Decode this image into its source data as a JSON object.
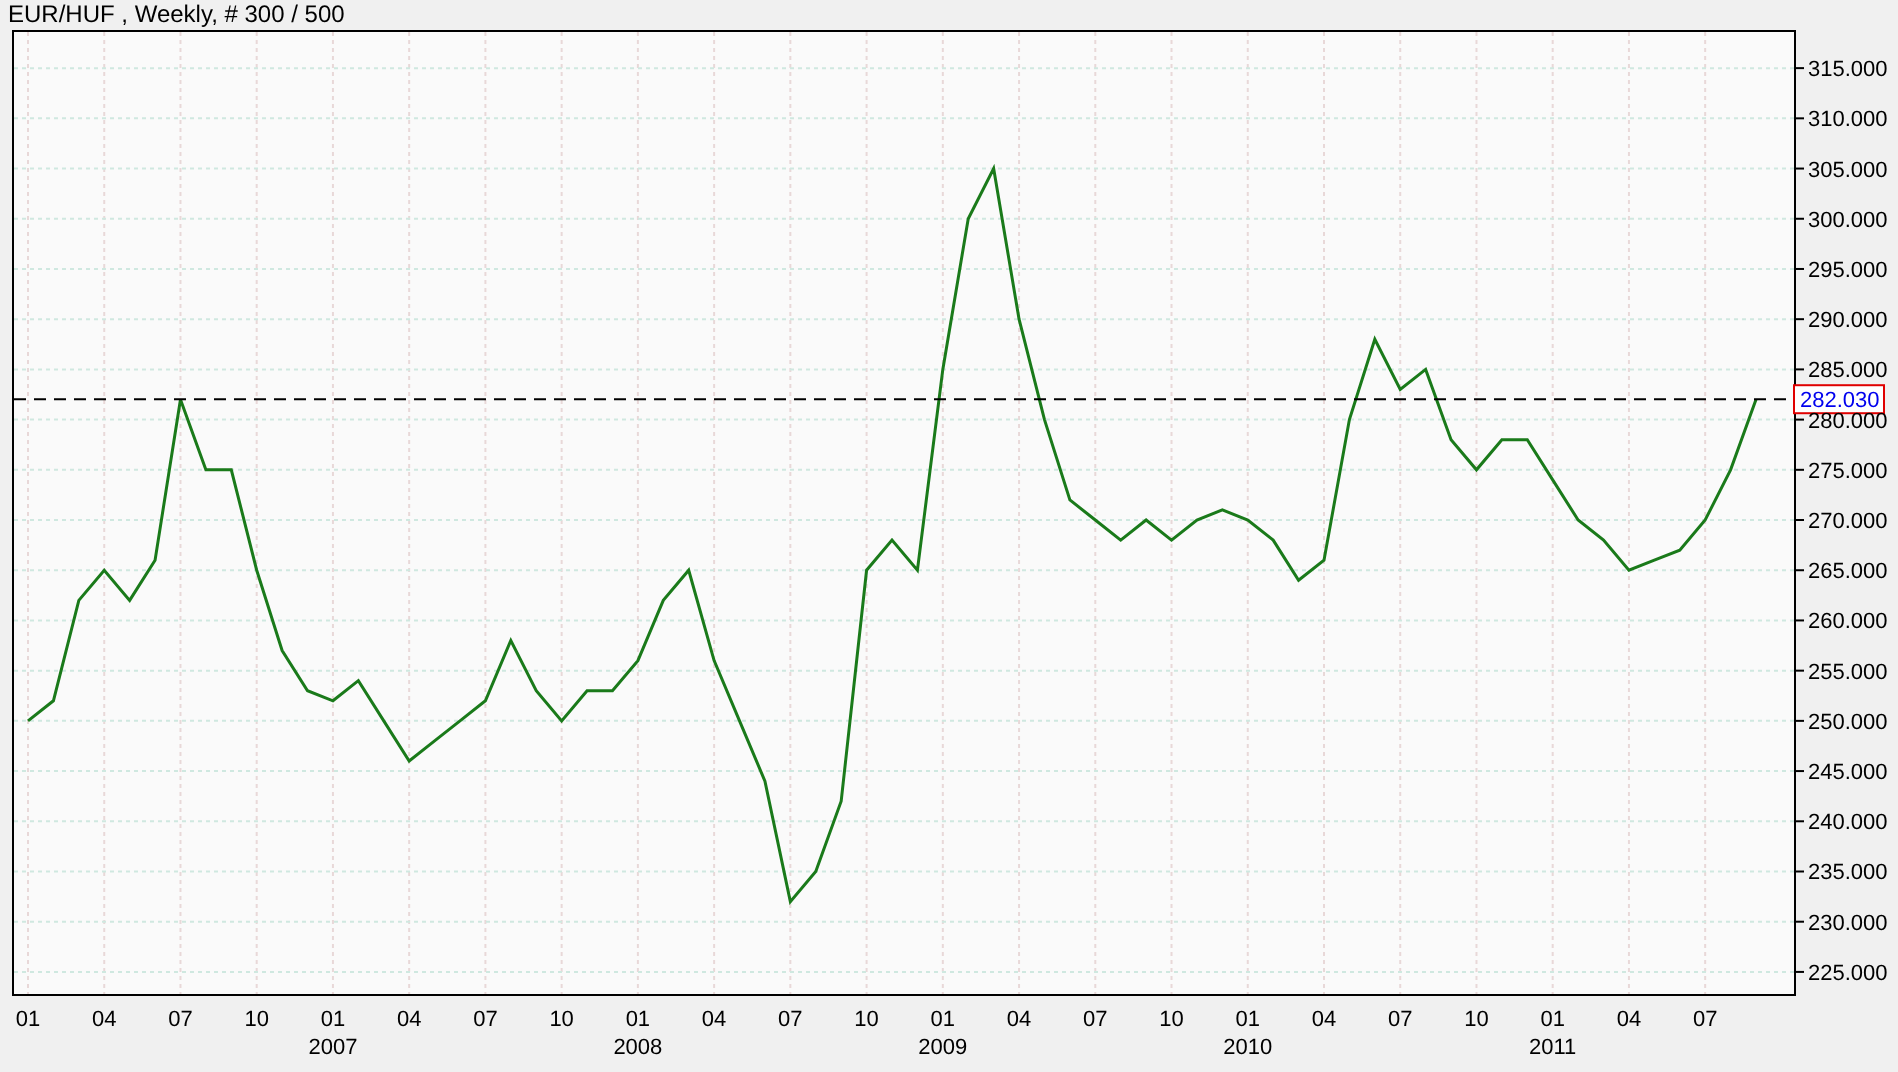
{
  "chart_title": "EUR/HUF , Weekly, # 300 / 500",
  "chart_data": {
    "type": "line",
    "categories": [
      "01",
      null,
      null,
      "04",
      null,
      null,
      "07",
      null,
      null,
      "10",
      null,
      null,
      "01",
      null,
      null,
      "04",
      null,
      null,
      "07",
      null,
      null,
      "10",
      null,
      null,
      "01",
      null,
      null,
      "04",
      null,
      null,
      "07",
      null,
      null,
      "10",
      null,
      null,
      "01",
      null,
      null,
      "04",
      null,
      null,
      "07",
      null,
      null,
      "10",
      null,
      null,
      "01",
      null,
      null,
      "04",
      null,
      null,
      "07",
      null,
      null,
      "10",
      null,
      null,
      "01",
      null,
      null,
      "04",
      null,
      null,
      "07",
      null,
      null
    ],
    "series": [
      {
        "color": "#1a7a1a",
        "values": [
          250,
          252,
          262,
          265,
          262,
          266,
          282,
          275,
          275,
          265,
          257,
          253,
          252,
          254,
          250,
          246,
          248,
          250,
          252,
          258,
          253,
          250,
          253,
          253,
          256,
          262,
          265,
          256,
          250,
          244,
          232,
          235,
          242,
          265,
          268,
          265,
          285,
          300,
          305,
          290,
          280,
          272,
          270,
          268,
          270,
          268,
          270,
          271,
          270,
          268,
          264,
          266,
          280,
          288,
          283,
          285,
          278,
          275,
          278,
          278,
          274,
          270,
          268,
          265,
          266,
          267,
          270,
          275,
          282
        ]
      }
    ],
    "ylim": [
      223,
      318
    ],
    "grid": true,
    "yticks": [
      {
        "value": 225,
        "label": "225.000"
      },
      {
        "value": 230,
        "label": "230.000"
      },
      {
        "value": 235,
        "label": "235.000"
      },
      {
        "value": 240,
        "label": "240.000"
      },
      {
        "value": 245,
        "label": "245.000"
      },
      {
        "value": 250,
        "label": "250.000"
      },
      {
        "value": 255,
        "label": "255.000"
      },
      {
        "value": 260,
        "label": "260.000"
      },
      {
        "value": 265,
        "label": "265.000"
      },
      {
        "value": 270,
        "label": "270.000"
      },
      {
        "value": 275,
        "label": "275.000"
      },
      {
        "value": 280,
        "label": "280.000"
      },
      {
        "value": 285,
        "label": "285.000"
      },
      {
        "value": 290,
        "label": "290.000"
      },
      {
        "value": 295,
        "label": "295.000"
      },
      {
        "value": 300,
        "label": "300.000"
      },
      {
        "value": 305,
        "label": "305.000"
      },
      {
        "value": 310,
        "label": "310.000"
      },
      {
        "value": 315,
        "label": "315.000"
      }
    ],
    "ref_lines": [
      {
        "axis": "y",
        "value": 282.03,
        "label": "282.030"
      }
    ]
  },
  "year_labels": [
    "2007",
    "2008",
    "2009",
    "2010",
    "2011"
  ]
}
